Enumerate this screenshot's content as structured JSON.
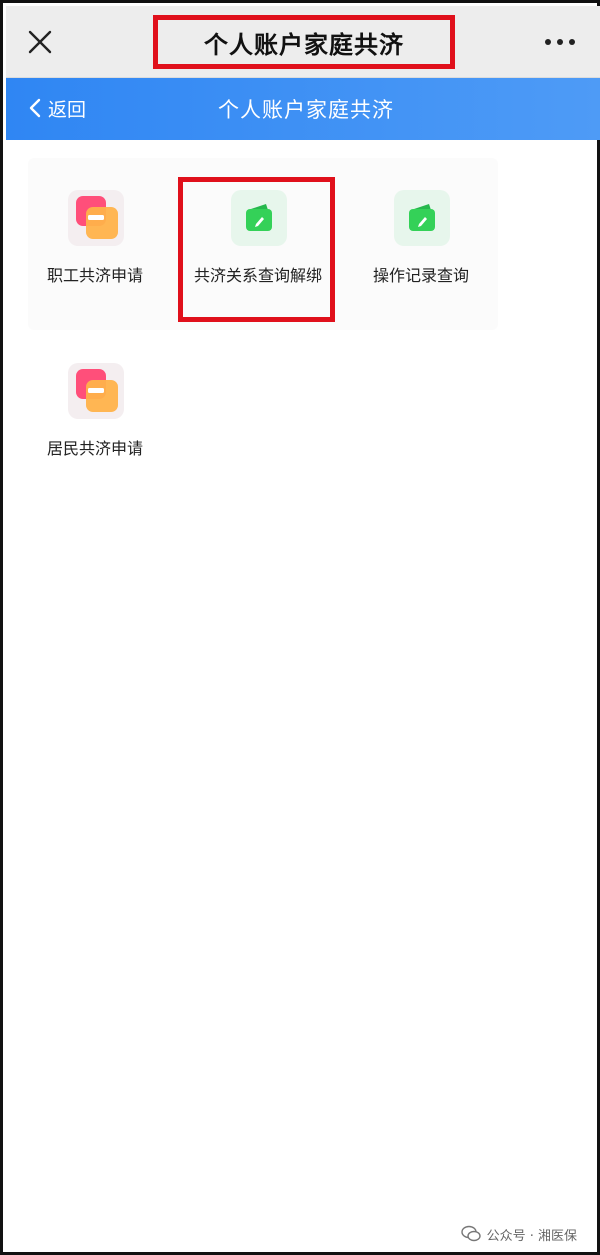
{
  "window": {
    "title": "个人账户家庭共济",
    "close_icon": "close-icon",
    "more_icon": "more-horizontal-icon"
  },
  "navbar": {
    "back_label": "返回",
    "title": "个人账户家庭共济",
    "color_start": "#2f86f3",
    "color_end": "#4e9bf6"
  },
  "services": [
    {
      "label": "职工共济申请",
      "icon": "application-card-icon",
      "color": "#ff5f7e"
    },
    {
      "label": "共济关系查询解绑",
      "icon": "wallet-edit-icon",
      "color": "#2ecc59"
    },
    {
      "label": "操作记录查询",
      "icon": "wallet-edit-icon",
      "color": "#2ecc59"
    },
    {
      "label": "居民共济申请",
      "icon": "application-card-icon",
      "color": "#ff5f7e"
    }
  ],
  "highlight_color": "#e0101b",
  "watermark": {
    "text": "公众号 · 湘医保",
    "icon": "wechat-icon"
  }
}
